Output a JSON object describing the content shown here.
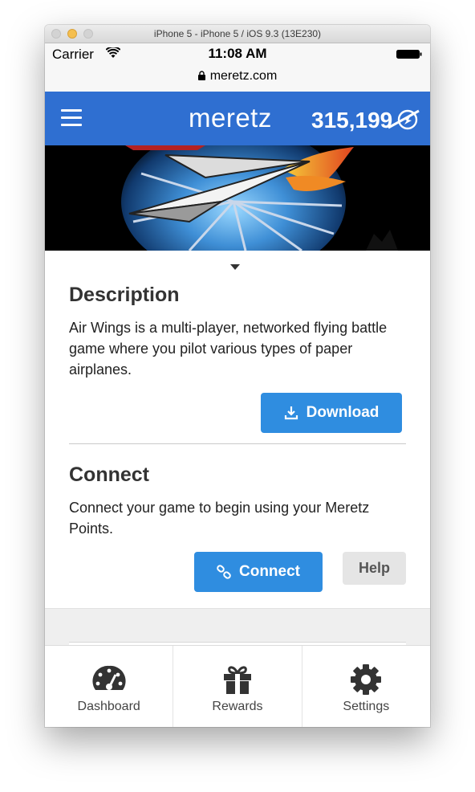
{
  "window": {
    "title": "iPhone 5 - iPhone 5 / iOS 9.3 (13E230)"
  },
  "status_bar": {
    "carrier": "Carrier",
    "time": "11:08 AM"
  },
  "url_bar": {
    "url": "meretz.com"
  },
  "header": {
    "brand": "meretz",
    "points": "315,199"
  },
  "description": {
    "heading": "Description",
    "text": "Air Wings is a multi-player, networked flying battle game where you pilot various types of paper airplanes.",
    "download_label": "Download"
  },
  "connect": {
    "heading": "Connect",
    "text": "Connect your game to begin using your Meretz Points.",
    "connect_label": "Connect",
    "help_label": "Help"
  },
  "tabs": [
    {
      "label": "Dashboard",
      "icon": "dashboard-icon"
    },
    {
      "label": "Rewards",
      "icon": "gift-icon"
    },
    {
      "label": "Settings",
      "icon": "gear-icon"
    }
  ],
  "colors": {
    "header_bg": "#2f6fd1",
    "primary_button": "#2f8de0",
    "help_button": "#e5e5e5"
  }
}
